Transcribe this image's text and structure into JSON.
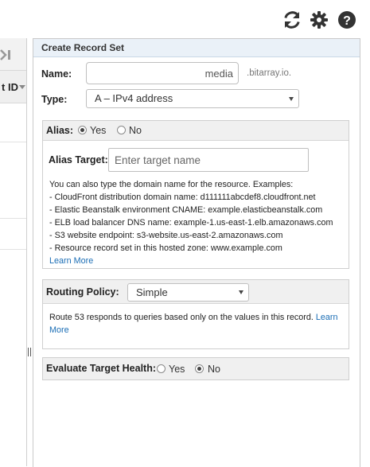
{
  "toolbar": {
    "refresh_icon": "refresh-icon",
    "settings_icon": "gear-icon",
    "help_icon": "help-icon"
  },
  "left_table": {
    "collapse_icon": "collapse-panel-icon",
    "column_header": "t ID"
  },
  "panel": {
    "title": "Create Record Set",
    "name": {
      "label": "Name:",
      "value": "media",
      "suffix": ".bitarray.io."
    },
    "type": {
      "label": "Type:",
      "selected": "A – IPv4 address"
    },
    "alias": {
      "label": "Alias:",
      "options": [
        "Yes",
        "No"
      ],
      "selected": "Yes",
      "target_label": "Alias Target:",
      "target_placeholder": "Enter target name",
      "help_lines": [
        "You can also type the domain name for the resource. Examples:",
        "-  CloudFront distribution domain name: d111111abcdef8.cloudfront.net",
        "-  Elastic Beanstalk environment CNAME: example.elasticbeanstalk.com",
        "-  ELB load balancer DNS name: example-1.us-east-1.elb.amazonaws.com",
        "-  S3 website endpoint: s3-website.us-east-2.amazonaws.com",
        "-  Resource record set in this hosted zone: www.example.com"
      ],
      "learn_more": "Learn More"
    },
    "routing": {
      "label": "Routing Policy:",
      "selected": "Simple",
      "help_line1": "Route 53 responds to queries based only on the values in this record.",
      "learn": "Learn",
      "more": "More"
    },
    "health": {
      "label": "Evaluate Target Health:",
      "options": [
        "Yes",
        "No"
      ],
      "selected": "No"
    }
  },
  "colors": {
    "link": "#1a6db5",
    "header_bg": "#eaf1f8",
    "section_bg": "#f0f0f0"
  }
}
